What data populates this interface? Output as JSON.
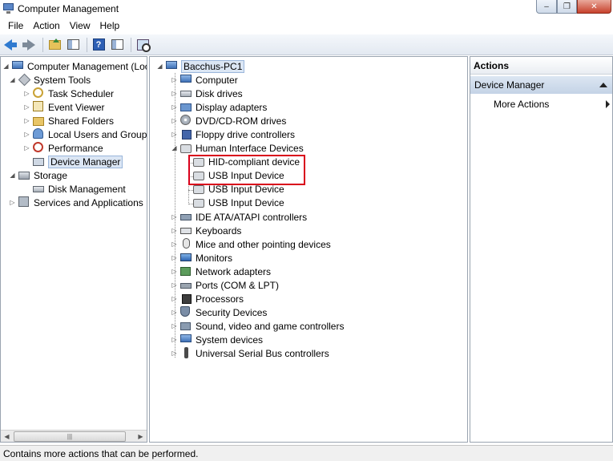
{
  "window": {
    "title": "Computer Management",
    "min_glyph": "‒",
    "max_glyph": "❐",
    "close_glyph": "✕"
  },
  "menu": [
    {
      "label": "File"
    },
    {
      "label": "Action"
    },
    {
      "label": "View"
    },
    {
      "label": "Help"
    }
  ],
  "toolbar": {
    "help_glyph": "?"
  },
  "left_tree": [
    {
      "label": "Computer Management (Local",
      "icon": "computer-management-icon",
      "expander": "◢"
    },
    {
      "label": "System Tools",
      "icon": "system-tools-icon",
      "expander": "◢"
    },
    {
      "label": "Task Scheduler",
      "icon": "task-scheduler-icon",
      "expander": "▷"
    },
    {
      "label": "Event Viewer",
      "icon": "event-viewer-icon",
      "expander": "▷"
    },
    {
      "label": "Shared Folders",
      "icon": "shared-folders-icon",
      "expander": "▷"
    },
    {
      "label": "Local Users and Groups",
      "icon": "local-users-icon",
      "expander": "▷"
    },
    {
      "label": "Performance",
      "icon": "performance-icon",
      "expander": "▷"
    },
    {
      "label": "Device Manager",
      "icon": "device-manager-icon",
      "expander": ""
    },
    {
      "label": "Storage",
      "icon": "storage-icon",
      "expander": "◢"
    },
    {
      "label": "Disk Management",
      "icon": "disk-management-icon",
      "expander": ""
    },
    {
      "label": "Services and Applications",
      "icon": "services-icon",
      "expander": "▷"
    }
  ],
  "left_scroll": {
    "left_arrow": "◀",
    "right_arrow": "▶",
    "grip": "|||"
  },
  "device_tree": {
    "root": {
      "label": "Bacchus-PC1",
      "expander": "◢"
    },
    "categories": [
      {
        "label": "Computer",
        "icon": "computer-icon",
        "expander": "▷"
      },
      {
        "label": "Disk drives",
        "icon": "disk-drive-icon",
        "expander": "▷"
      },
      {
        "label": "Display adapters",
        "icon": "display-adapter-icon",
        "expander": "▷"
      },
      {
        "label": "DVD/CD-ROM drives",
        "icon": "dvd-icon",
        "expander": "▷"
      },
      {
        "label": "Floppy drive controllers",
        "icon": "floppy-icon",
        "expander": "▷"
      },
      {
        "label": "Human Interface Devices",
        "icon": "hid-icon",
        "expander": "◢"
      },
      {
        "label": "IDE ATA/ATAPI controllers",
        "icon": "ide-icon",
        "expander": "▷"
      },
      {
        "label": "Keyboards",
        "icon": "keyboard-icon",
        "expander": "▷"
      },
      {
        "label": "Mice and other pointing devices",
        "icon": "mouse-icon",
        "expander": "▷"
      },
      {
        "label": "Monitors",
        "icon": "monitor-icon",
        "expander": "▷"
      },
      {
        "label": "Network adapters",
        "icon": "network-icon",
        "expander": "▷"
      },
      {
        "label": "Ports (COM & LPT)",
        "icon": "ports-icon",
        "expander": "▷"
      },
      {
        "label": "Processors",
        "icon": "processor-icon",
        "expander": "▷"
      },
      {
        "label": "Security Devices",
        "icon": "security-icon",
        "expander": "▷"
      },
      {
        "label": "Sound, video and game controllers",
        "icon": "sound-icon",
        "expander": "▷"
      },
      {
        "label": "System devices",
        "icon": "system-devices-icon",
        "expander": "▷"
      },
      {
        "label": "Universal Serial Bus controllers",
        "icon": "usb-icon",
        "expander": "▷"
      }
    ],
    "hid_children": [
      {
        "label": "HID-compliant device"
      },
      {
        "label": "USB Input Device"
      },
      {
        "label": "USB Input Device"
      },
      {
        "label": "USB Input Device"
      }
    ]
  },
  "actions": {
    "header": "Actions",
    "section": "Device Manager",
    "items": [
      {
        "label": "More Actions"
      }
    ]
  },
  "status": {
    "text": "Contains more actions that can be performed."
  },
  "colors": {
    "highlight_box": "#d9001b",
    "section_bg": "#c4d3e6"
  }
}
